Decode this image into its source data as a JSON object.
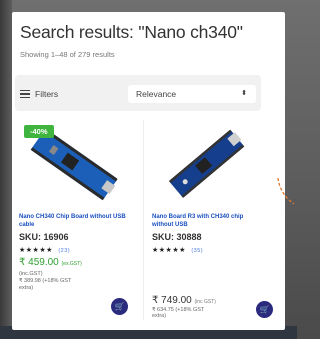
{
  "search": {
    "title": "Search results: \"Nano ch340\"",
    "count": "Showing 1–48 of 279 results"
  },
  "filters": {
    "label": "Filters",
    "sort_selected": "Relevance"
  },
  "products": [
    {
      "badge": "-40%",
      "name": "Nano CH340 Chip Board without USB cable",
      "sku": "SKU: 16906",
      "stars": "★★★★★",
      "reviews": "(23)",
      "price": "₹ 459.00",
      "price_note": "(ex.GST)",
      "line1": "(inc.GST)",
      "line2": "₹ 389.98 (+18% GST",
      "line3": "extra)"
    },
    {
      "name": "Nano Board R3 with CH340 chip without USB",
      "sku": "SKU: 30888",
      "stars": "★★★★★",
      "reviews": "(35)",
      "price": "₹ 749.00",
      "price_note": "(inc GST)",
      "line1": "₹ 634.75 (+18% GST",
      "line2": "extra)"
    }
  ],
  "colors": {
    "accent_blue": "#1a4fbf",
    "sale_green": "#3fb53f",
    "cart_button": "#2a2a7e"
  }
}
